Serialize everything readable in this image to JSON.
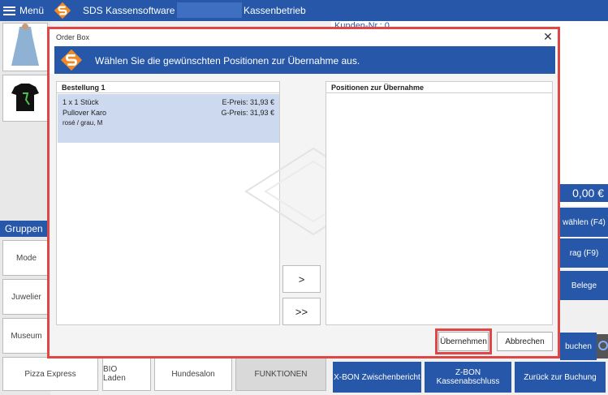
{
  "topbar": {
    "menu_label": "Menü",
    "app_title": "SDS Kassensoftware",
    "mode_title": "Kassenbetrieb",
    "kunden_label": "Kunden-Nr.: 0"
  },
  "colors": {
    "primary": "#2657a8",
    "highlight_border": "#e04646",
    "selection": "#cdd9ef"
  },
  "side": {
    "groups_label": "Gruppen",
    "total": "0,00 €"
  },
  "groups": [
    "Mode",
    "Juwelier",
    "Museum",
    "Pizza Express",
    "BIO Laden",
    "Hundesalon",
    "FUNKTIONEN"
  ],
  "right_buttons": [
    "wählen (F4)",
    "rag (F9)",
    "Belege",
    "buchen"
  ],
  "bottom_buttons": {
    "xbon": "X-BON Zwischenbericht",
    "zbon_line1": "Z-BON",
    "zbon_line2": "Kassenabschluss",
    "back": "Zurück zur Buchung"
  },
  "dialog": {
    "title": "Order Box",
    "instruction": "Wählen Sie die gewünschten Positionen zur Übernahme aus.",
    "left_header": "Bestellung 1",
    "right_header": "Positionen zur Übernahme",
    "item": {
      "qty": "1 x 1 Stück",
      "name": "Pullover Karo",
      "variant": "rosé / grau, M",
      "e_price": "E-Preis: 31,93 €",
      "g_price": "G-Preis: 31,93 €"
    },
    "move_one": ">",
    "move_all": ">>",
    "accept": "Übernehmen",
    "cancel": "Abbrechen"
  }
}
